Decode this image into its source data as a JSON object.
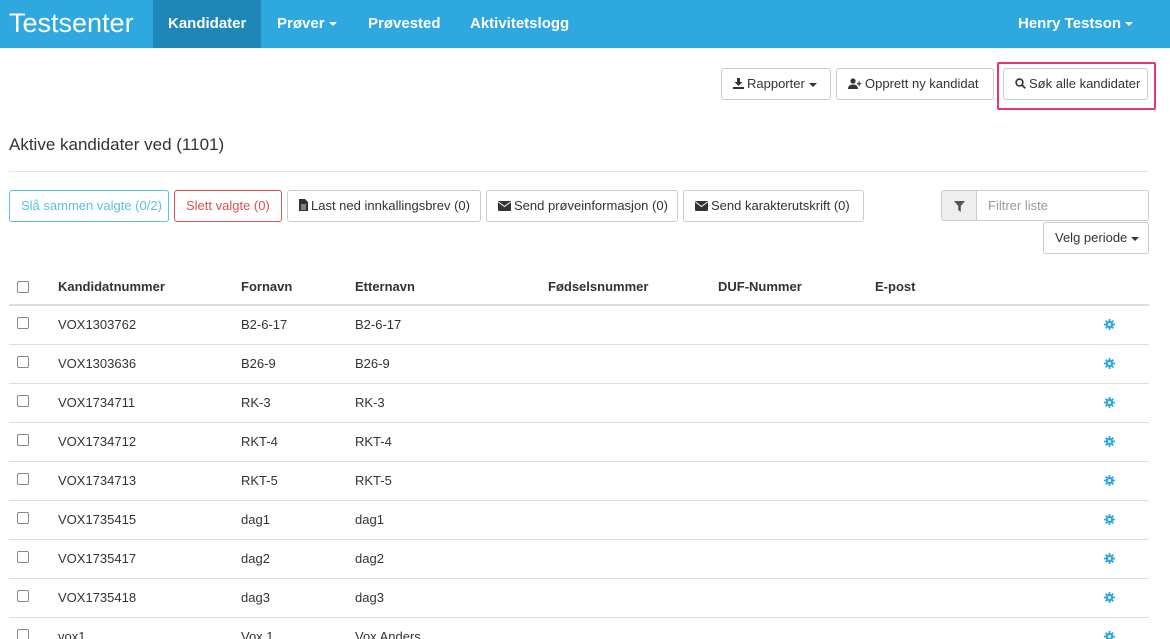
{
  "navbar": {
    "brand": "Testsenter",
    "items": [
      {
        "label": "Kandidater",
        "active": true
      },
      {
        "label": "Prøver",
        "dropdown": true
      },
      {
        "label": "Prøvested"
      },
      {
        "label": "Aktivitetslogg"
      }
    ],
    "user": "Henry Testson",
    "color": "#2ea8df",
    "active_color": "#1f87b7"
  },
  "toolbar": {
    "reports": "Rapporter",
    "create": "Opprett ny kandidat",
    "search": "Søk alle kandidater"
  },
  "heading": "Aktive kandidater ved (1101)",
  "actions": {
    "merge": "Slå sammen valgte (0/2)",
    "delete": "Slett valgte (0)",
    "download": "Last ned innkallingsbrev (0)",
    "send_info": "Send prøveinformasjon (0)",
    "send_transcript": "Send karakterutskrift (0)"
  },
  "filter": {
    "placeholder": "Filtrer liste"
  },
  "period": "Velg periode",
  "table": {
    "headers": [
      "Kandidatnummer",
      "Fornavn",
      "Etternavn",
      "Fødselsnummer",
      "DUF-Nummer",
      "E-post"
    ],
    "rows": [
      [
        "VOX1303762",
        "B2-6-17",
        "B2-6-17"
      ],
      [
        "VOX1303636",
        "B26-9",
        "B26-9"
      ],
      [
        "VOX1734711",
        "RK-3",
        "RK-3"
      ],
      [
        "VOX1734712",
        "RKT-4",
        "RKT-4"
      ],
      [
        "VOX1734713",
        "RKT-5",
        "RKT-5"
      ],
      [
        "VOX1735415",
        "dag1",
        "dag1"
      ],
      [
        "VOX1735417",
        "dag2",
        "dag2"
      ],
      [
        "VOX1735418",
        "dag3",
        "dag3"
      ],
      [
        "vox1",
        "Vox 1",
        "Vox Anders"
      ]
    ]
  },
  "icons": {
    "gear": "gear-icon",
    "gear_color": "#2ea8df"
  }
}
